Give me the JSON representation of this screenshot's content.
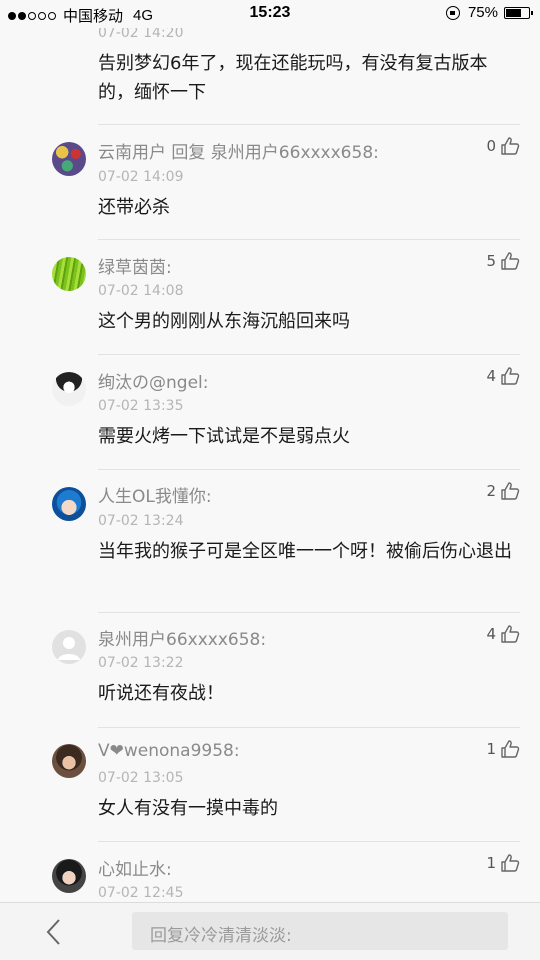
{
  "status_bar": {
    "carrier": "中国移动",
    "network": "4G",
    "time": "15:23",
    "battery_text": "75%",
    "battery_level": 0.75,
    "signal_bars": 2
  },
  "comments": [
    {
      "name": "",
      "time": "07-02 14:20",
      "text": "告别梦幻6年了，现在还能玩吗，有没有复古版本的，缅怀一下",
      "likes": ""
    },
    {
      "name": "云南用户 回复 泉州用户66xxxx658:",
      "time": "07-02 14:09",
      "text": "还带必杀",
      "likes": "0"
    },
    {
      "name": "绿草茵茵:",
      "time": "07-02 14:08",
      "text": "这个男的刚刚从东海沉船回来吗",
      "likes": "5"
    },
    {
      "name": "绚汰の@ngel:",
      "time": "07-02 13:35",
      "text": "需要火烤一下试试是不是弱点火",
      "likes": "4"
    },
    {
      "name": "人生OL我懂你:",
      "time": "07-02 13:24",
      "text": "当年我的猴子可是全区唯一一个呀！被偷后伤心退出",
      "likes": "2"
    },
    {
      "name": "泉州用户66xxxx658:",
      "time": "07-02 13:22",
      "text": "听说还有夜战！",
      "likes": "4"
    },
    {
      "name": "V❤wenona9958:",
      "time": "07-02 13:05",
      "text": "女人有没有一摸中毒的",
      "likes": "1"
    },
    {
      "name": "心如止水:",
      "time": "07-02 12:45",
      "text": "",
      "likes": "1"
    }
  ],
  "reply_bar": {
    "placeholder": "回复冷冷清清淡淡:"
  },
  "icons": {
    "like": "thumbs-up-icon",
    "back": "chevron-left-icon",
    "lock": "rotation-lock-icon"
  }
}
